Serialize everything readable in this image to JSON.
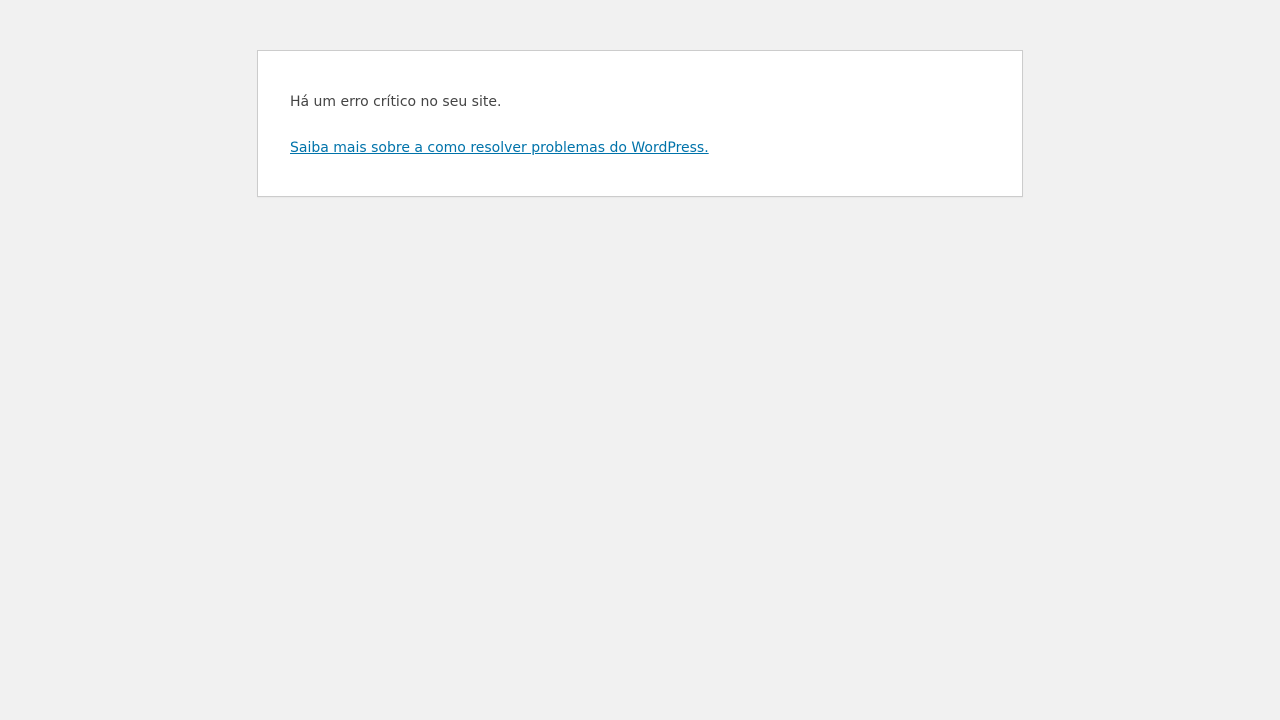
{
  "error": {
    "message": "Há um erro crítico no seu site.",
    "help_link_text": "Saiba mais sobre a como resolver problemas do WordPress."
  },
  "colors": {
    "background": "#f1f1f1",
    "panel": "#ffffff",
    "panel_border": "#cccccc",
    "text": "#444444",
    "link": "#0073aa"
  }
}
